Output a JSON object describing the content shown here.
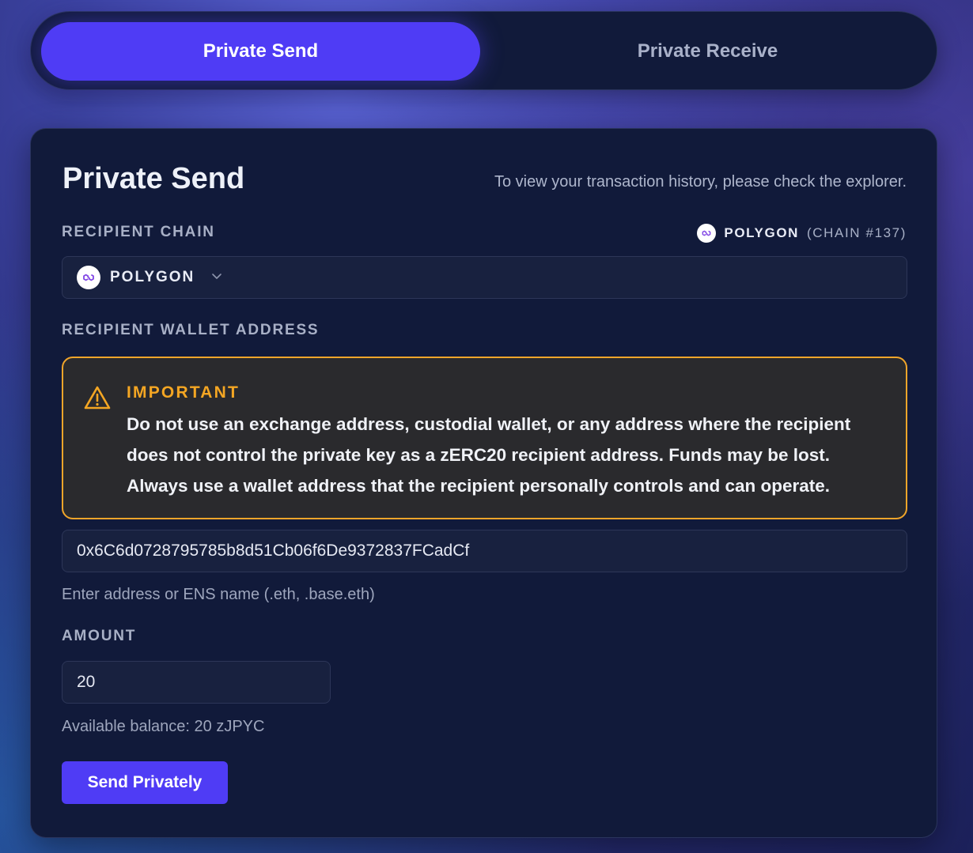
{
  "tabs": {
    "send": "Private Send",
    "receive": "Private Receive"
  },
  "card": {
    "title": "Private Send",
    "history_note": "To view your transaction history, please check the explorer."
  },
  "recipient_chain": {
    "label": "RECIPIENT CHAIN",
    "current_name": "POLYGON",
    "current_id": "(CHAIN #137)",
    "selected": "POLYGON"
  },
  "recipient_wallet": {
    "label": "RECIPIENT WALLET ADDRESS",
    "warning_title": "IMPORTANT",
    "warning_body": "Do not use an exchange address, custodial wallet, or any address where the recipient does not control the private key as a zERC20 recipient address. Funds may be lost. Always use a wallet address that the recipient personally controls and can operate.",
    "value": "0x6C6d0728795785b8d51Cb06f6De9372837FCadCf",
    "hint": "Enter address or ENS name (.eth, .base.eth)"
  },
  "amount": {
    "label": "AMOUNT",
    "value": "20",
    "balance": "Available balance: 20 zJPYC"
  },
  "submit": {
    "label": "Send Privately"
  },
  "colors": {
    "accent": "#4f3cf5",
    "warning": "#f0a52a",
    "panel": "#111a3a",
    "polygon": "#8247e5"
  }
}
